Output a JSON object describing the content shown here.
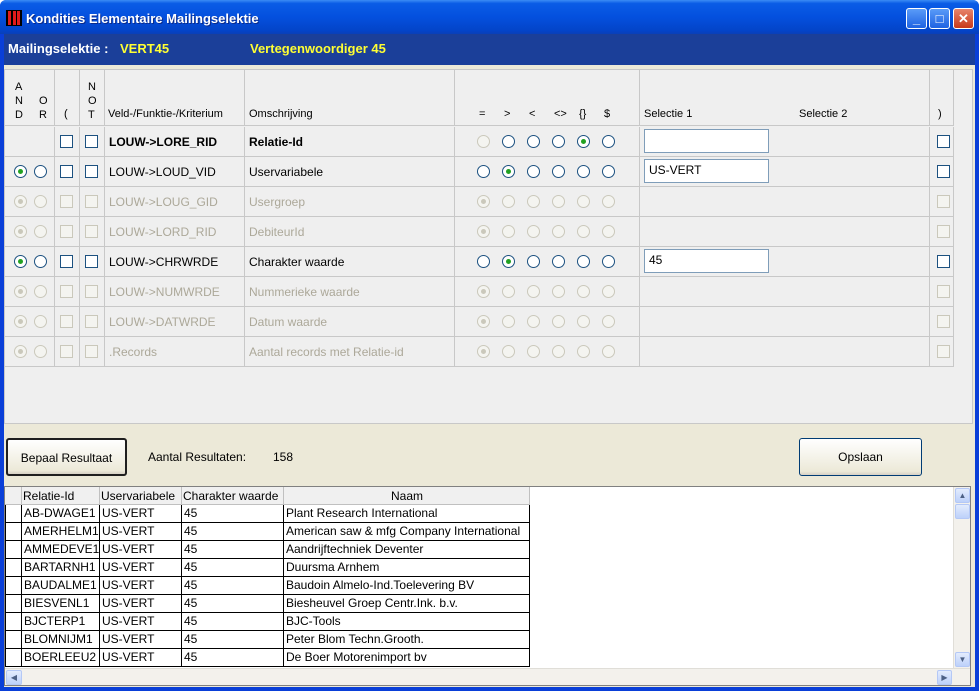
{
  "window": {
    "title": "Kondities Elementaire Mailingselektie",
    "minimize": "_",
    "maximize": "□",
    "close": "✕"
  },
  "info": {
    "label": "Mailingselektie :",
    "code": "VERT45",
    "name": "Vertegenwoordiger 45"
  },
  "criteria": {
    "headers": {
      "and": "A\nN\nD",
      "or": "O\nR",
      "paren_open": "(",
      "not": "N\nO\nT",
      "field": "Veld-/Funktie-/Kriterium",
      "description": "Omschrijving",
      "ops": [
        "=",
        ">",
        "<",
        "<>",
        "{}",
        "$"
      ],
      "sel1": "Selectie 1",
      "sel2": "Selectie 2",
      "paren_close": ")"
    },
    "rows": [
      {
        "field": "LOUW->LORE_RID",
        "desc": "Relatie-Id",
        "bold": true,
        "disabled": false,
        "andor": "none",
        "op": 4,
        "sel1": "",
        "show_input": true,
        "last_faint": false
      },
      {
        "field": "LOUW->LOUD_VID",
        "desc": "Uservariabele",
        "bold": false,
        "disabled": false,
        "andor": "and",
        "op": 1,
        "sel1": "US-VERT",
        "show_input": true,
        "last_faint": false
      },
      {
        "field": "LOUW->LOUG_GID",
        "desc": "Usergroep",
        "bold": false,
        "disabled": true,
        "andor": "and",
        "op": 0,
        "sel1": "",
        "show_input": false,
        "last_faint": false
      },
      {
        "field": "LOUW->LORD_RID",
        "desc": "DebiteurId",
        "bold": false,
        "disabled": true,
        "andor": "and",
        "op": 0,
        "sel1": "",
        "show_input": false,
        "last_faint": false
      },
      {
        "field": "LOUW->CHRWRDE",
        "desc": "Charakter waarde",
        "bold": false,
        "disabled": false,
        "andor": "and",
        "op": 1,
        "sel1": "45",
        "show_input": true,
        "last_faint": false
      },
      {
        "field": "LOUW->NUMWRDE",
        "desc": "Nummerieke waarde",
        "bold": false,
        "disabled": true,
        "andor": "and",
        "op": 0,
        "sel1": "",
        "show_input": false,
        "last_faint": true
      },
      {
        "field": "LOUW->DATWRDE",
        "desc": "Datum waarde",
        "bold": false,
        "disabled": true,
        "andor": "and",
        "op": 0,
        "sel1": "",
        "show_input": false,
        "last_faint": false
      },
      {
        "field": ".Records",
        "desc": "Aantal records met Relatie-id",
        "bold": false,
        "disabled": true,
        "andor": "and",
        "op": 0,
        "sel1": "",
        "show_input": false,
        "last_faint": true
      }
    ]
  },
  "actions": {
    "bepaal": "Bepaal Resultaat",
    "aantal_label": "Aantal Resultaten:",
    "aantal_value": "158",
    "opslaan": "Opslaan"
  },
  "results": {
    "columns": [
      "Relatie-Id",
      "Uservariabele",
      "Charakter waarde",
      "Naam"
    ],
    "rows": [
      [
        "AB-DWAGE1",
        "US-VERT",
        "45",
        "Plant Research International"
      ],
      [
        "AMERHELM1",
        "US-VERT",
        "45",
        "American saw & mfg Company International"
      ],
      [
        "AMMEDEVE1",
        "US-VERT",
        "45",
        "Aandrijftechniek Deventer"
      ],
      [
        "BARTARNH1",
        "US-VERT",
        "45",
        "Duursma Arnhem"
      ],
      [
        "BAUDALME1",
        "US-VERT",
        "45",
        "Baudoin Almelo-Ind.Toelevering BV"
      ],
      [
        "BIESVENL1",
        "US-VERT",
        "45",
        "Biesheuvel Groep Centr.Ink. b.v."
      ],
      [
        "BJCTERP1",
        "US-VERT",
        "45",
        "BJC-Tools"
      ],
      [
        "BLOMNIJM1",
        "US-VERT",
        "45",
        "Peter Blom Techn.Grooth."
      ],
      [
        "BOERLEEU2",
        "US-VERT",
        "45",
        "De Boer Motorenimport bv"
      ]
    ]
  }
}
